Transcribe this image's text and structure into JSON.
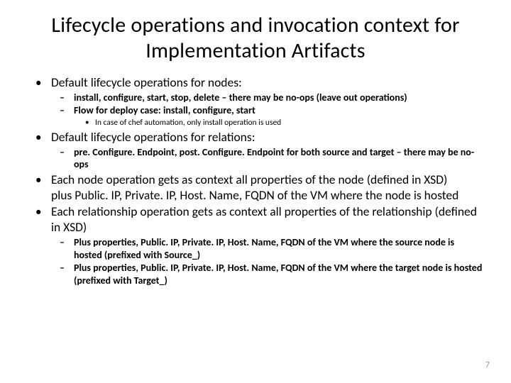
{
  "title": "Lifecycle operations and invocation context for Implementation Artifacts",
  "b1": "Default lifecycle operations for nodes:",
  "b1s1": "install, configure, start, stop, delete – there may be no-ops (leave out operations)",
  "b1s2": "Flow for deploy case: install, configure, start",
  "b1s2s1": "In case of chef automation, only install operation is used",
  "b2": "Default lifecycle operations for relations:",
  "b2s1": "pre. Configure. Endpoint, post. Configure. Endpoint for both source and target – there may be no-ops",
  "b3": "Each node operation gets as context all properties of the node (defined in XSD)\nplus Public. IP, Private. IP, Host. Name, FQDN of the VM where the node is hosted",
  "b4": "Each relationship operation gets as context all properties of the relationship (defined in XSD)",
  "b4s1": "Plus properties, Public. IP, Private. IP, Host. Name, FQDN of the VM where the source node is hosted (prefixed with Source_)",
  "b4s2": "Plus properties, Public. IP, Private. IP, Host. Name, FQDN of the VM where the target node is hosted (prefixed with Target_)",
  "pagenum": "7"
}
